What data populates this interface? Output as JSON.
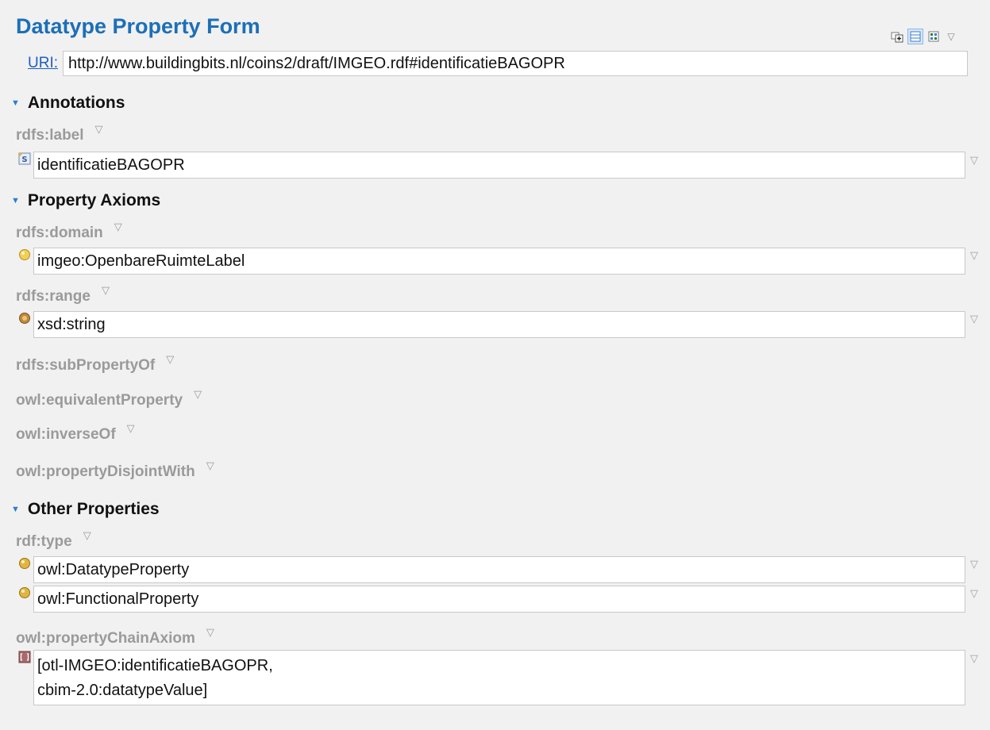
{
  "form": {
    "title": "Datatype Property Form"
  },
  "toolbar": {
    "icons": [
      "add-widget-icon",
      "collapse-view-icon",
      "grid-view-icon",
      "view-menu-chevron-icon"
    ]
  },
  "uri": {
    "label": "URI:",
    "value": "http://www.buildingbits.nl/coins2/draft/IMGEO.rdf#identificatieBAGOPR"
  },
  "sections": {
    "annotations": {
      "title": "Annotations"
    },
    "axioms": {
      "title": "Property Axioms"
    },
    "other": {
      "title": "Other Properties"
    }
  },
  "props": {
    "label": {
      "name": "rdfs:label",
      "values": [
        {
          "text": "identificatieBAGOPR",
          "icon": "string-literal-icon"
        }
      ]
    },
    "domain": {
      "name": "rdfs:domain",
      "values": [
        {
          "text": "imgeo:OpenbareRuimteLabel",
          "icon": "class-icon"
        }
      ]
    },
    "range": {
      "name": "rdfs:range",
      "values": [
        {
          "text": "xsd:string",
          "icon": "datatype-icon"
        }
      ]
    },
    "subPropertyOf": {
      "name": "rdfs:subPropertyOf"
    },
    "equivalentProperty": {
      "name": "owl:equivalentProperty"
    },
    "inverseOf": {
      "name": "owl:inverseOf"
    },
    "propertyDisjointWith": {
      "name": "owl:propertyDisjointWith"
    },
    "type": {
      "name": "rdf:type",
      "values": [
        {
          "text": "owl:DatatypeProperty",
          "icon": "class-icon"
        },
        {
          "text": "owl:FunctionalProperty",
          "icon": "class-icon"
        }
      ]
    },
    "propertyChainAxiom": {
      "name": "owl:propertyChainAxiom",
      "values": [
        {
          "lines": [
            "[otl-IMGEO:identificatieBAGOPR,",
            "cbim-2.0:datatypeValue]"
          ],
          "icon": "list-icon"
        }
      ]
    }
  },
  "colors": {
    "title": "#1c6fb7",
    "link": "#1f5fbf",
    "label": "#9a9a9a",
    "section": "#111111",
    "twisty": "#2c7cd1"
  }
}
